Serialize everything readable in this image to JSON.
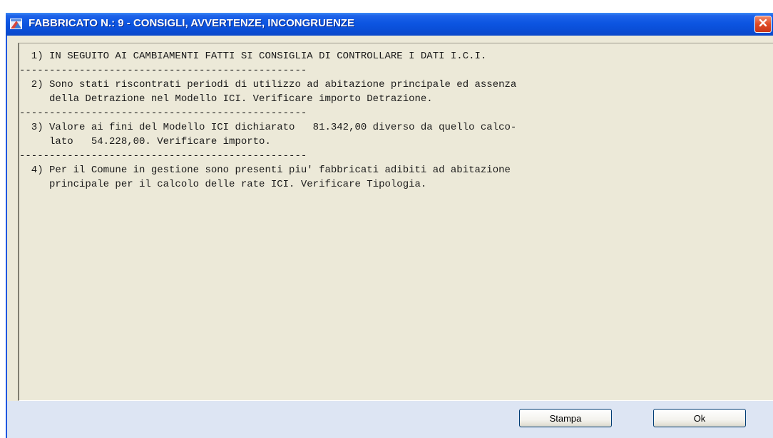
{
  "window": {
    "title": "FABBRICATO N.: 9 - CONSIGLI, AVVERTENZE, INCONGRUENZE",
    "app_icon": "app-window-icon",
    "close_icon": "close-icon"
  },
  "messages": {
    "text": "  1) IN SEGUITO AI CAMBIAMENTI FATTI SI CONSIGLIA DI CONTROLLARE I DATI I.C.I.\n------------------------------------------------\n  2) Sono stati riscontrati periodi di utilizzo ad abitazione principale ed assenza\n     della Detrazione nel Modello ICI. Verificare importo Detrazione.\n------------------------------------------------\n  3) Valore ai fini del Modello ICI dichiarato   81.342,00 diverso da quello calco-\n     lato   54.228,00. Verificare importo.\n------------------------------------------------\n  4) Per il Comune in gestione sono presenti piu' fabbricati adibiti ad abitazione\n     principale per il calcolo delle rate ICI. Verificare Tipologia."
  },
  "buttons": {
    "print_label": "Stampa",
    "ok_label": "Ok"
  },
  "colors": {
    "titlebar": "#0a4ed7",
    "client_background": "#ece9d8",
    "footer_background": "#dde5f3",
    "close_button": "#df4a23"
  }
}
